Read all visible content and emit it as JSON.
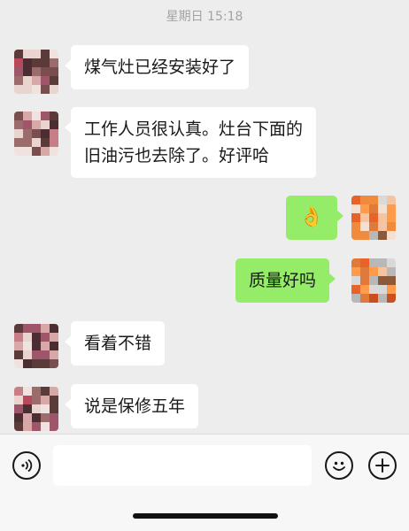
{
  "chat": {
    "timestamp": "星期日 15:18",
    "messages": [
      {
        "side": "left",
        "text": "煤气灶已经安装好了"
      },
      {
        "side": "left",
        "text_line1": "工作人员很认真。灶台下面的",
        "text_line2": "旧油污也去除了。好评哈"
      },
      {
        "side": "right",
        "text": "👌"
      },
      {
        "side": "right",
        "text": "质量好吗"
      },
      {
        "side": "left",
        "text": "看着不错"
      },
      {
        "side": "left",
        "text": "说是保修五年"
      }
    ]
  },
  "input_bar": {
    "voice_icon": "voice-icon",
    "emoji_icon": "emoji-icon",
    "plus_icon": "plus-icon",
    "input_value": ""
  },
  "colors": {
    "background": "#ededed",
    "incoming_bubble": "#ffffff",
    "outgoing_bubble": "#95ec69",
    "timestamp": "#a3a3a3"
  }
}
